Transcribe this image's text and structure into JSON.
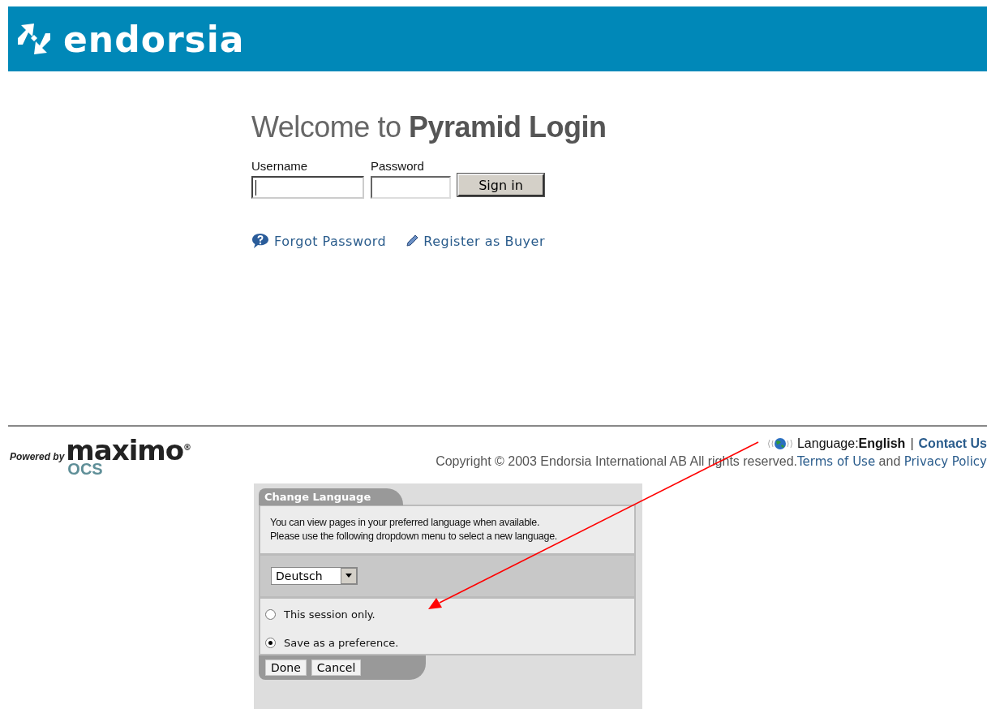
{
  "header": {
    "logo_text": "endorsia"
  },
  "login": {
    "title": "Welcome to **Pyramid Login**",
    "fields": [
      {
        "label": "Username",
        "focused": true
      },
      {
        "label": "Password",
        "focused": false
      }
    ],
    "submit": "Sign in",
    "links": [
      {
        "kind": "help",
        "text": "Forgot Password"
      },
      {
        "kind": "edit",
        "text": "Register as Buyer"
      }
    ]
  },
  "footer": {
    "powered_by": {
      "prefix": "Powered by",
      "brand": "maximo",
      "mark": "®",
      "sub": "OCS"
    },
    "language": {
      "text": "Language:**English**",
      "separator": "|",
      "contact": "Contact Us"
    },
    "copyright": {
      "text": "Copyright © 2003 Endorsia International AB All rights reserved.",
      "terms": "Terms of Use",
      "joiner": "and",
      "privacy": "Privacy Policy"
    }
  },
  "dialog": {
    "title": "Change Language",
    "message": [
      "You can view pages in your preferred language when available.",
      "Please use the following dropdown menu to select a new language."
    ],
    "language_select": "Deutsch",
    "options": [
      {
        "label": "This session only.",
        "selected": false
      },
      {
        "label": "Save as a preference.",
        "selected": true
      }
    ],
    "buttons": [
      "Done",
      "Cancel"
    ]
  }
}
